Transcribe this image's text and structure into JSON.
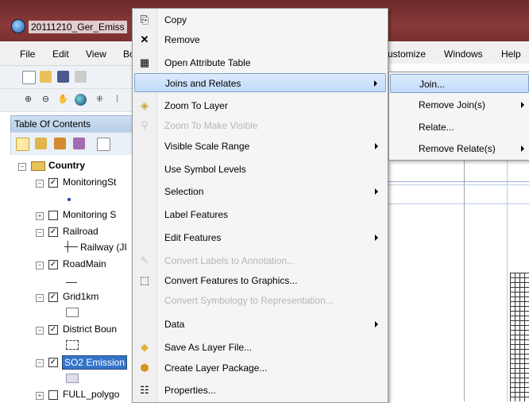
{
  "window": {
    "title": "20111210_Ger_Emiss"
  },
  "menubar": {
    "left_items": [
      "File",
      "Edit",
      "View",
      "Bo"
    ],
    "right_items": [
      "ustomize",
      "Windows",
      "Help"
    ]
  },
  "toc": {
    "title": "Table Of Contents",
    "layers": [
      {
        "name": "Country",
        "bold": true,
        "expanded": true
      },
      {
        "name": "MonitoringSt",
        "checked": true,
        "expanded": true
      },
      {
        "name": "Monitoring S",
        "checked": false,
        "expanded": false
      },
      {
        "name": "Railroad",
        "checked": true,
        "expanded": true,
        "legend": "Railway (JI"
      },
      {
        "name": "RoadMain",
        "checked": true,
        "expanded": true
      },
      {
        "name": "Grid1km",
        "checked": true,
        "expanded": true
      },
      {
        "name": "District Boun",
        "checked": true,
        "expanded": true
      },
      {
        "name": "SO2 Emission",
        "checked": true,
        "expanded": true,
        "selected": true
      },
      {
        "name": "FULL_polygo",
        "checked": false,
        "expanded": false
      }
    ]
  },
  "context_menu": {
    "items": [
      {
        "label": "Copy",
        "icon": "copy-icon",
        "enabled": true
      },
      {
        "label": "Remove",
        "icon": "remove-icon",
        "enabled": true
      },
      {
        "label": "Open Attribute Table",
        "icon": "table-icon",
        "enabled": true
      },
      {
        "label": "Joins and Relates",
        "icon": "",
        "enabled": true,
        "submenu": true,
        "highlighted": true
      },
      {
        "label": "Zoom To Layer",
        "icon": "zoom-to-layer-icon",
        "enabled": true
      },
      {
        "label": "Zoom To Make Visible",
        "icon": "zoom-visible-icon",
        "enabled": false
      },
      {
        "label": "Visible Scale Range",
        "icon": "",
        "enabled": true,
        "submenu": true
      },
      {
        "label": "Use Symbol Levels",
        "icon": "",
        "enabled": true
      },
      {
        "label": "Selection",
        "icon": "",
        "enabled": true,
        "submenu": true
      },
      {
        "label": "Label Features",
        "icon": "",
        "enabled": true
      },
      {
        "label": "Edit Features",
        "icon": "",
        "enabled": true,
        "submenu": true
      },
      {
        "label": "Convert Labels to Annotation...",
        "icon": "convert-labels-icon",
        "enabled": false
      },
      {
        "label": "Convert Features to Graphics...",
        "icon": "convert-graphics-icon",
        "enabled": true
      },
      {
        "label": "Convert Symbology to Representation...",
        "icon": "",
        "enabled": false
      },
      {
        "label": "Data",
        "icon": "",
        "enabled": true,
        "submenu": true
      },
      {
        "label": "Save As Layer File...",
        "icon": "layer-file-icon",
        "enabled": true
      },
      {
        "label": "Create Layer Package...",
        "icon": "layer-package-icon",
        "enabled": true
      },
      {
        "label": "Properties...",
        "icon": "properties-icon",
        "enabled": true
      }
    ]
  },
  "submenu": {
    "items": [
      {
        "label": "Join...",
        "highlighted": true,
        "submenu": false
      },
      {
        "label": "Remove Join(s)",
        "submenu": true
      },
      {
        "label": "Relate...",
        "submenu": false
      },
      {
        "label": "Remove Relate(s)",
        "submenu": true
      }
    ]
  },
  "colors": {
    "highlight": "#c1dbfc",
    "highlight_border": "#7da2ce",
    "titlebar": "#7a3030"
  }
}
